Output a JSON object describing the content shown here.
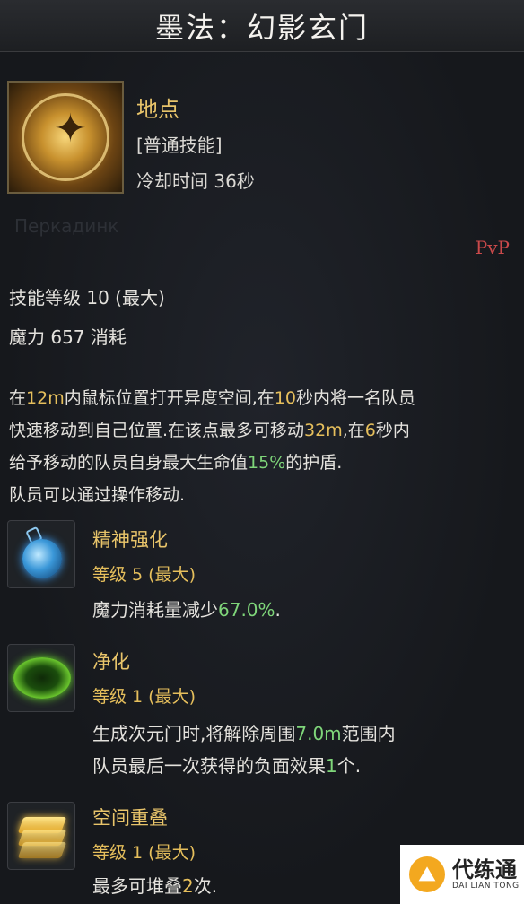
{
  "header": {
    "title": "墨法：幻影玄门"
  },
  "skill": {
    "name": "地点",
    "type": "[普通技能]",
    "cooldown": "冷却时间 36秒",
    "faint_text": "Перкадинк",
    "pvp_tag": "PvP",
    "level": "技能等级 10 (最大)",
    "mana": "魔力 657 消耗",
    "description": {
      "l1": [
        "在",
        "12m",
        "内鼠标位置打开异度空间,在",
        "10",
        "秒内将一名队员"
      ],
      "l2": [
        "快速移动到自己位置.在该点最多可移动",
        "32m",
        ",在",
        "6",
        "秒内"
      ],
      "l3": [
        "给予移动的队员自身最大生命值",
        "15%",
        "的护盾."
      ],
      "l4": "队员可以通过操作移动."
    }
  },
  "tripods": [
    {
      "name": "精神强化",
      "level": "等级 5 (最大)",
      "icon": "blue-flask-icon",
      "desc": [
        "魔力消耗量减少",
        "67.0%",
        "."
      ]
    },
    {
      "name": "净化",
      "level": "等级 1 (最大)",
      "icon": "green-circle-icon",
      "desc1": [
        "生成次元门时,将解除周围",
        "7.0m",
        "范围内"
      ],
      "desc2": [
        "队员最后一次获得的负面效果",
        "1",
        "个."
      ]
    },
    {
      "name": "空间重叠",
      "level": "等级 1 (最大)",
      "icon": "stacked-layers-icon",
      "desc": [
        "最多可堆叠",
        "2",
        "次."
      ]
    }
  ],
  "watermark": {
    "main": "代练通",
    "sub": "DAI LIAN TONG"
  },
  "colors": {
    "gold": "#e8c46a",
    "green": "#7fd67a",
    "pvp_red": "#c9494a",
    "background": "#17191d"
  }
}
